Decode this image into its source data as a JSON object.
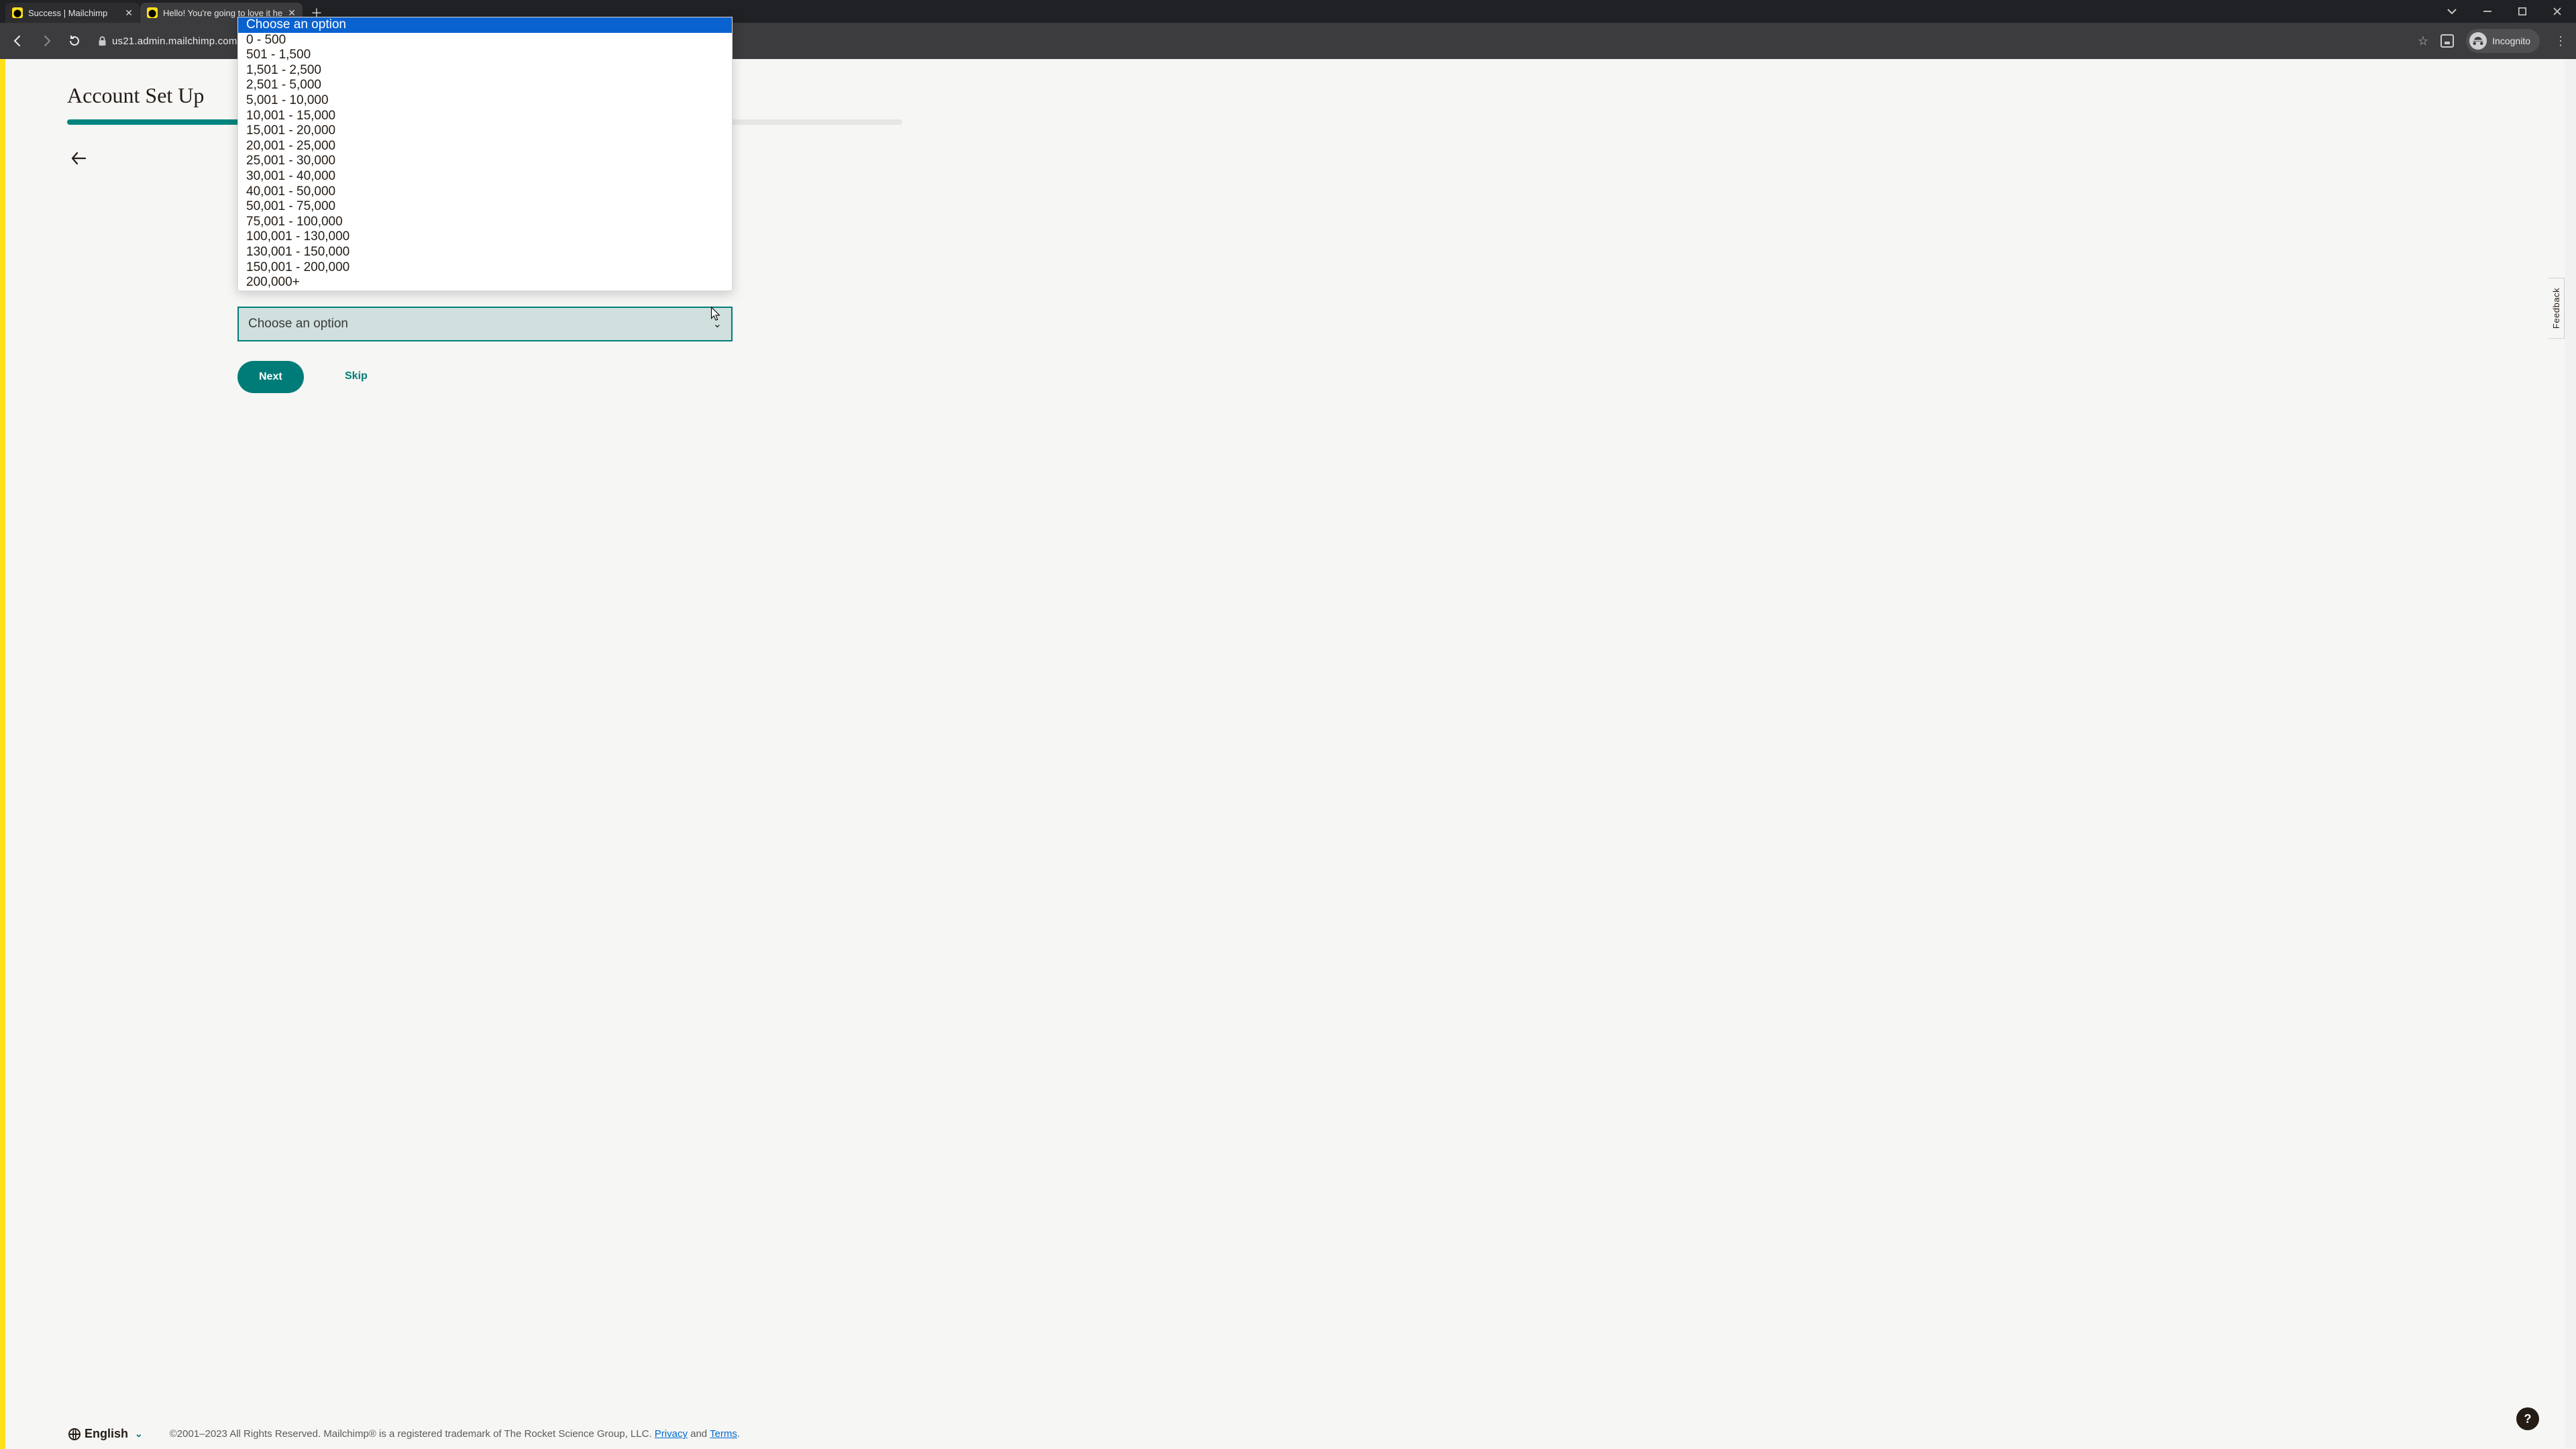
{
  "browser": {
    "tabs": [
      {
        "title": "Success | Mailchimp",
        "active": false
      },
      {
        "title": "Hello! You're going to love it he",
        "active": true
      }
    ],
    "url": "us21.admin.mailchimp.com",
    "incognito_label": "Incognito"
  },
  "page": {
    "heading": "Account Set Up",
    "progress_pct": 29,
    "back_label": "Back",
    "select_placeholder": "Choose an option",
    "options": [
      "Choose an option",
      "0 - 500",
      "501 - 1,500",
      "1,501 - 2,500",
      "2,501 - 5,000",
      "5,001 - 10,000",
      "10,001 - 15,000",
      "15,001 - 20,000",
      "20,001 - 25,000",
      "25,001 - 30,000",
      "30,001 - 40,000",
      "40,001 - 50,000",
      "50,001 - 75,000",
      "75,001 - 100,000",
      "100,001 - 130,000",
      "130,001 - 150,000",
      "150,001 - 200,000",
      "200,000+"
    ],
    "selected_index": 0,
    "next_label": "Next",
    "skip_label": "Skip",
    "feedback_label": "Feedback",
    "help_label": "?"
  },
  "footer": {
    "language": "English",
    "copyright_pre": "©2001–2023 All Rights Reserved. Mailchimp® is a registered trademark of The Rocket Science Group, LLC. ",
    "privacy": "Privacy",
    "and": " and ",
    "terms": "Terms",
    "period": "."
  }
}
